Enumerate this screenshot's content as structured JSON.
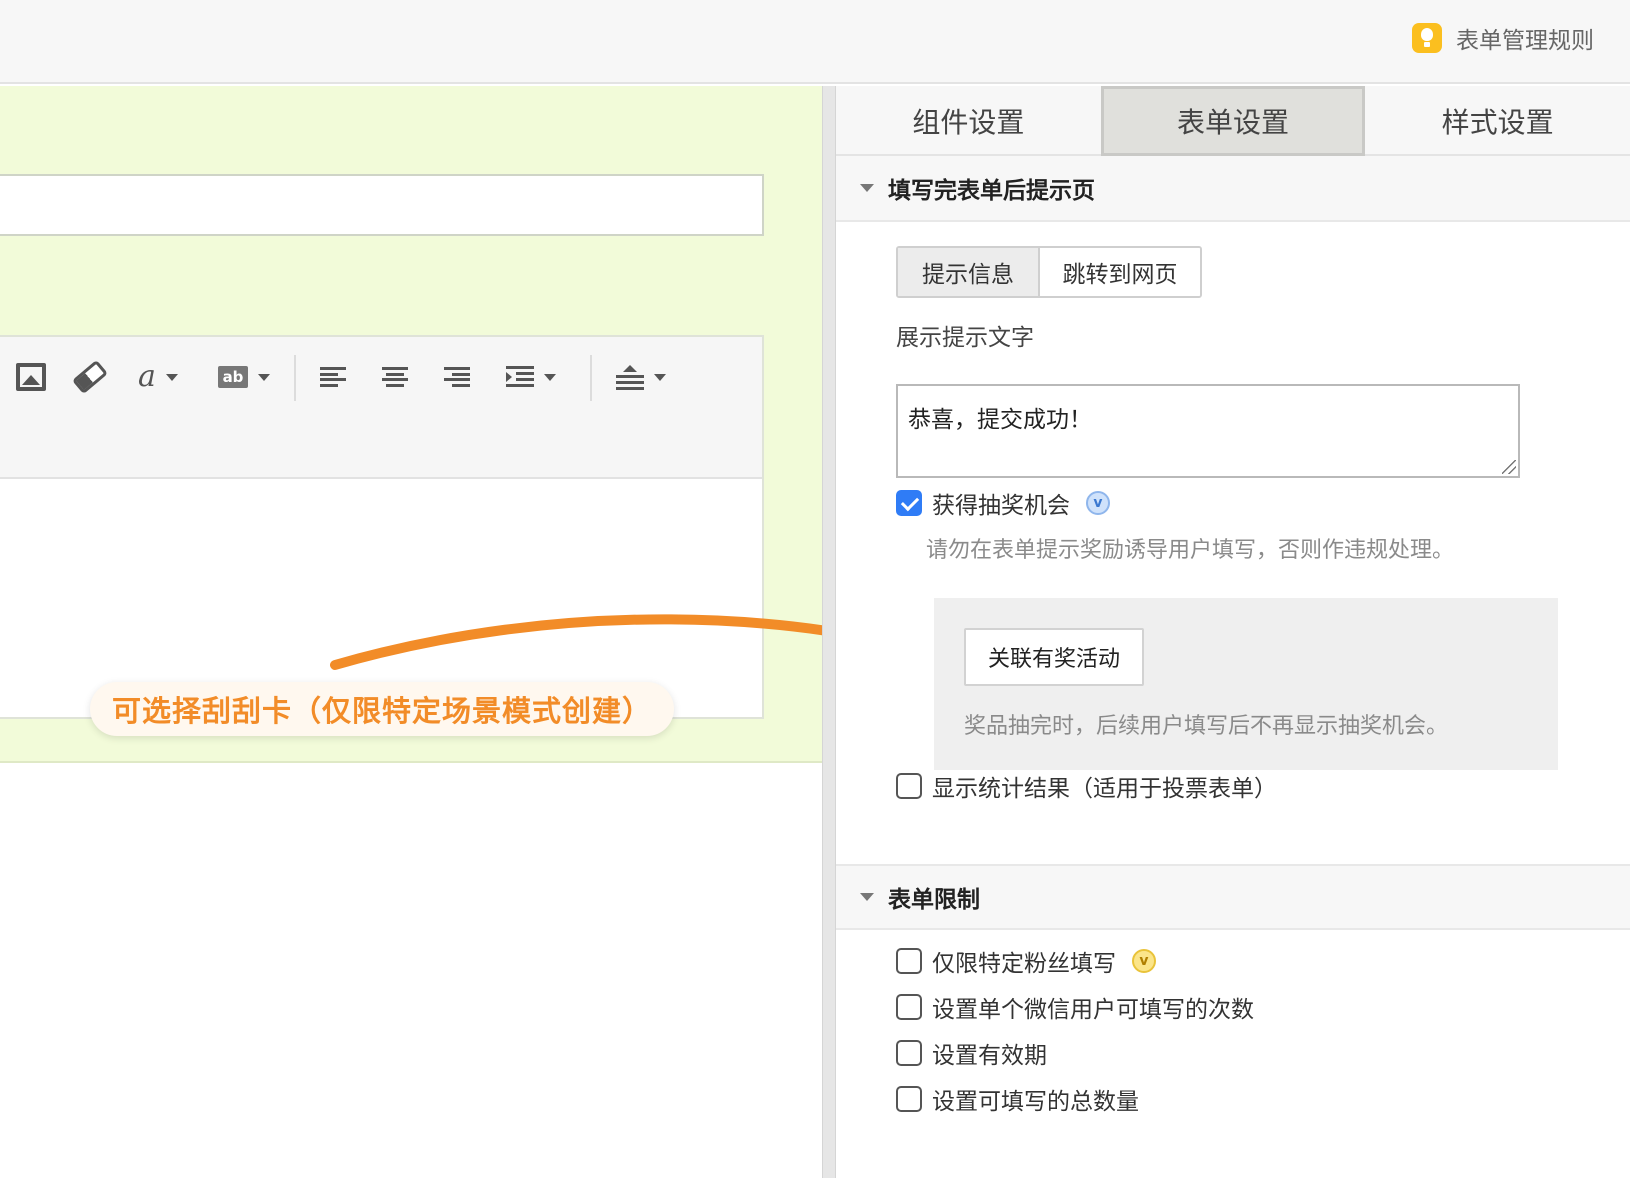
{
  "header": {
    "rules_link": "表单管理规则",
    "rules_icon": "lightbulb-icon"
  },
  "annotation": {
    "callout": "可选择刮刮卡（仅限特定场景模式创建）",
    "arrow_color": "#f28c28"
  },
  "editor": {
    "title_value": "",
    "toolbar_icons": [
      "image-icon",
      "eraser-icon",
      "font-color-icon",
      "highlight-icon",
      "align-left-icon",
      "align-center-icon",
      "align-right-icon",
      "indent-icon",
      "line-height-icon"
    ]
  },
  "panel": {
    "tabs": [
      {
        "label": "组件设置",
        "active": false
      },
      {
        "label": "表单设置",
        "active": true
      },
      {
        "label": "样式设置",
        "active": false
      }
    ],
    "section_after_submit": {
      "title": "填写完表单后提示页",
      "segments": [
        "提示信息",
        "跳转到网页"
      ],
      "active_segment": "提示信息",
      "text_label": "展示提示文字",
      "text_value": "恭喜，提交成功！",
      "lottery": {
        "label": "获得抽奖机会",
        "checked": true,
        "vip_badge": "v",
        "warning": "请勿在表单提示奖励诱导用户填写，否则作违规处理。",
        "link_button": "关联有奖活动",
        "note": "奖品抽完时，后续用户填写后不再显示抽奖机会。"
      },
      "show_stats": {
        "label": "显示统计结果（适用于投票表单）",
        "checked": false
      }
    },
    "section_limits": {
      "title": "表单限制",
      "options": [
        {
          "label": "仅限特定粉丝填写",
          "checked": false,
          "vip_badge": "v"
        },
        {
          "label": "设置单个微信用户可填写的次数",
          "checked": false
        },
        {
          "label": "设置有效期",
          "checked": false
        },
        {
          "label": "设置可填写的总数量",
          "checked": false
        }
      ]
    }
  },
  "colors": {
    "accent_blue": "#2f7cf6",
    "annotation_orange": "#f28c28",
    "editor_bg": "#f2fbd9"
  }
}
